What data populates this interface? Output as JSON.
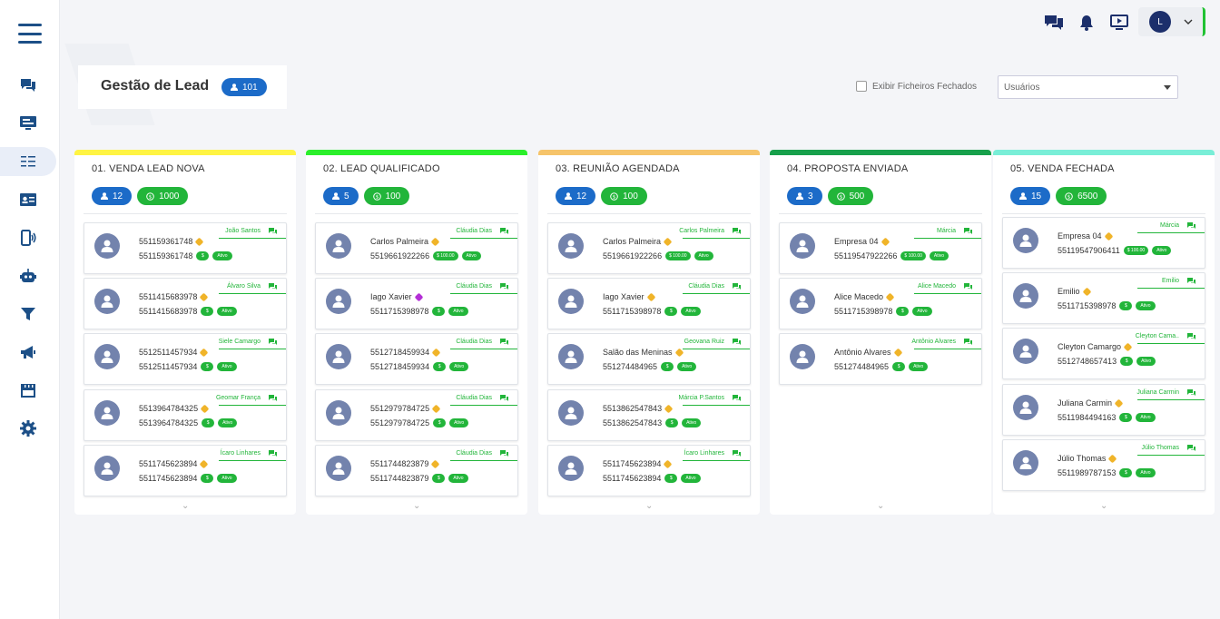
{
  "header": {
    "title": "Gestão de Lead",
    "total_count": "101",
    "checkbox_label": "Exibir Ficheiros Fechados",
    "select_value": "Usuários"
  },
  "user": {
    "initial": "L"
  },
  "colors": {
    "primary": "#1c6bc8",
    "green": "#22b53a",
    "nav": "#1c4f87"
  },
  "sidebar": {
    "items": [
      "chat-icon",
      "monitor-icon",
      "kanban-list-icon",
      "contact-card-icon",
      "phone-sound-icon",
      "robot-icon",
      "filter-icon",
      "megaphone-icon",
      "store-icon",
      "gear-icon"
    ]
  },
  "columns": [
    {
      "title": "01. VENDA LEAD NOVA",
      "color": "#fff443",
      "count": "12",
      "value": "1000",
      "cards": [
        {
          "name": "551159361748",
          "phone": "551159361748",
          "owner": "João Santos",
          "tag": "#f0b429",
          "value": ""
        },
        {
          "name": "5511415683978",
          "phone": "5511415683978",
          "owner": "Álvaro Silva",
          "tag": "#f0b429",
          "value": ""
        },
        {
          "name": "5512511457934",
          "phone": "5512511457934",
          "owner": "Siele Camargo",
          "tag": "#f0b429",
          "value": ""
        },
        {
          "name": "5513964784325",
          "phone": "5513964784325",
          "owner": "Geomar França",
          "tag": "#f0b429",
          "value": ""
        },
        {
          "name": "5511745623894",
          "phone": "5511745623894",
          "owner": "Ícaro Linhares",
          "tag": "#f0b429",
          "value": ""
        }
      ]
    },
    {
      "title": "02. LEAD QUALIFICADO",
      "color": "#2bef2b",
      "count": "5",
      "value": "100",
      "cards": [
        {
          "name": "Carlos Palmeira",
          "phone": "5519661922266",
          "owner": "Cláudia Dias",
          "tag": "#f0b429",
          "value": "100.00"
        },
        {
          "name": "Iago Xavier",
          "phone": "551171539897​8",
          "owner": "Cláudia Dias",
          "tag": "#b42fd6",
          "value": ""
        },
        {
          "name": "5512718459934",
          "phone": "5512718459934",
          "owner": "Cláudia Dias",
          "tag": "#f0b429",
          "value": ""
        },
        {
          "name": "5512979784725",
          "phone": "5512979784725",
          "owner": "Cláudia Dias",
          "tag": "#f0b429",
          "value": ""
        },
        {
          "name": "5511744823879",
          "phone": "5511744823879",
          "owner": "Cláudia Dias",
          "tag": "#f0b429",
          "value": ""
        }
      ]
    },
    {
      "title": "03. REUNIÃO AGENDADA",
      "color": "#f6c46a",
      "count": "12",
      "value": "100",
      "cards": [
        {
          "name": "Carlos Palmeira",
          "phone": "5519661922266",
          "owner": "Carlos Palmeira",
          "tag": "#f0b429",
          "value": "100.00"
        },
        {
          "name": "Iago Xavier",
          "phone": "5511715398978",
          "owner": "Cláudia Dias",
          "tag": "#f0b429",
          "value": ""
        },
        {
          "name": "Salão das Meninas",
          "phone": "551274484965",
          "owner": "Geovana Ruiz",
          "tag": "#f0b429",
          "value": ""
        },
        {
          "name": "5513862547843",
          "phone": "5513862547843",
          "owner": "Márcia P.Santos",
          "tag": "#f0b429",
          "value": ""
        },
        {
          "name": "5511745623894",
          "phone": "5511745623894",
          "owner": "Ícaro Linhares",
          "tag": "#f0b429",
          "value": ""
        }
      ]
    },
    {
      "title": "04. PROPOSTA ENVIADA",
      "color": "#17a04b",
      "count": "3",
      "value": "500",
      "cards": [
        {
          "name": "Empresa 04",
          "phone": "5511954792226​6",
          "owner": "Márcia",
          "tag": "#f0b429",
          "value": "100.00"
        },
        {
          "name": "Alice Macedo",
          "phone": "5511715398978",
          "owner": "Alice Macedo",
          "tag": "#f0b429",
          "value": ""
        },
        {
          "name": "Antônio Alvares",
          "phone": "551274484965",
          "owner": "Antônio Alvares",
          "tag": "#f0b429",
          "value": ""
        }
      ]
    },
    {
      "title": "05. VENDA FECHADA",
      "color": "#79eed7",
      "count": "15",
      "value": "6500",
      "cards": [
        {
          "name": "Empresa 04",
          "phone": "55119547906411",
          "owner": "Márcia",
          "tag": "#f0b429",
          "value": "100.00"
        },
        {
          "name": "Emilio",
          "phone": "5511715398978",
          "owner": "Emilio",
          "tag": "#f0b429",
          "value": ""
        },
        {
          "name": "Cleyton Camargo",
          "phone": "5512748657413",
          "owner": "Cleyton Cama..",
          "tag": "#f0b429",
          "value": ""
        },
        {
          "name": "Juliana Carmin",
          "phone": "5511984494163",
          "owner": "Juliana Carmin",
          "tag": "#f0b429",
          "value": ""
        },
        {
          "name": "Júlio Thomas",
          "phone": "5511989787153",
          "owner": "Júlio Thomas",
          "tag": "#f0b429",
          "value": ""
        }
      ]
    }
  ],
  "labels": {
    "active": "Ativo",
    "currency": "$"
  }
}
